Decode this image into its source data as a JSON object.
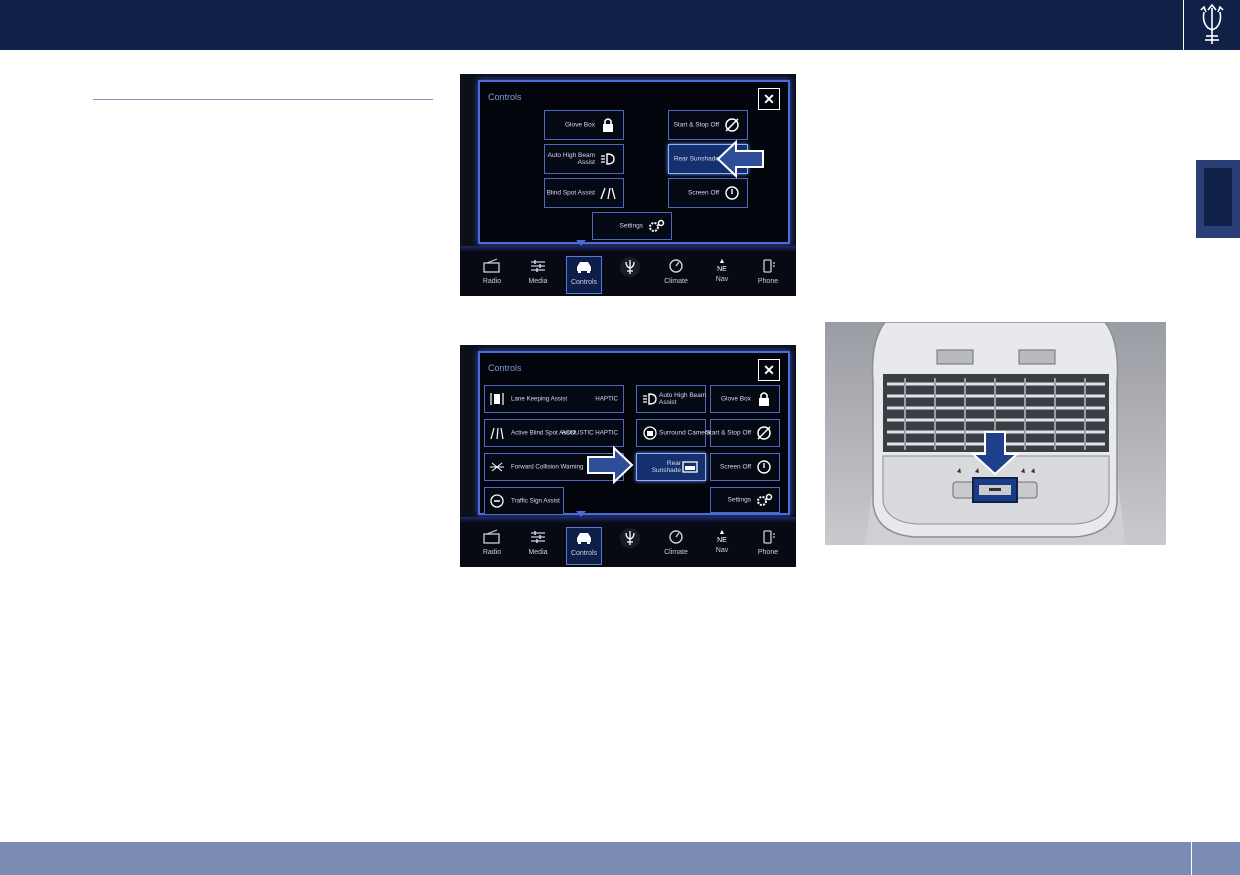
{
  "shot1": {
    "panel_title": "Controls",
    "close_label": "✕",
    "buttons": [
      {
        "label": "Glove Box"
      },
      {
        "label": "Start & Stop Off"
      },
      {
        "label": "Auto High Beam Assist"
      },
      {
        "label": "Rear Sunshade"
      },
      {
        "label": "Blind Spot Assist"
      },
      {
        "label": "Screen Off"
      },
      {
        "label": "Settings"
      }
    ]
  },
  "shot2": {
    "panel_title": "Controls",
    "close_label": "✕",
    "rows": [
      {
        "label": "Lane Keeping Assist",
        "value": "HAPTIC"
      },
      {
        "label": "Active Blind Spot Assist",
        "value": "ACOUSTIC HAPTIC"
      },
      {
        "label": "Forward Collision Warning",
        "value": ""
      },
      {
        "label": "Traffic Sign Assist",
        "value": ""
      }
    ],
    "buttons": [
      {
        "label": "Auto High Beam Assist"
      },
      {
        "label": "Glove Box"
      },
      {
        "label": "Surround Camera"
      },
      {
        "label": "Start & Stop Off"
      },
      {
        "label": "Rear Sunshade"
      },
      {
        "label": "Screen Off"
      },
      {
        "label": "Settings"
      }
    ]
  },
  "nav": [
    "Radio",
    "Media",
    "Controls",
    "",
    "Climate",
    "Nav",
    "Phone"
  ],
  "compass": "NE"
}
